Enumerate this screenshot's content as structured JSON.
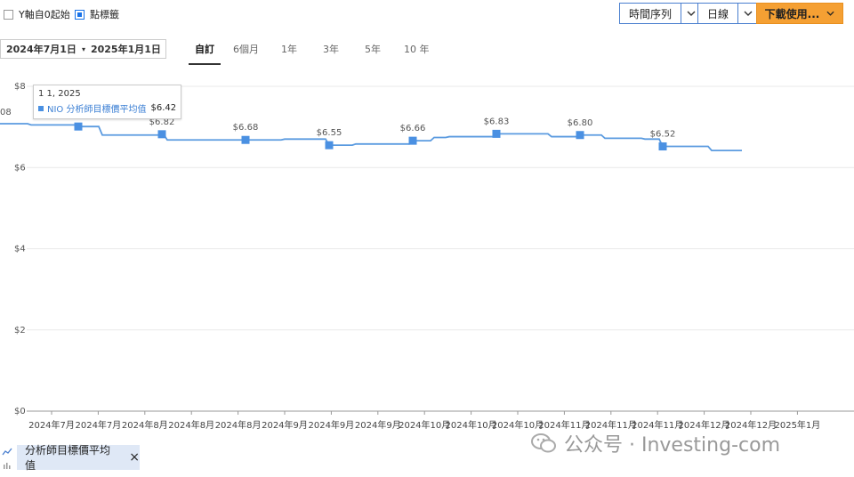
{
  "toolbar": {
    "y_from_zero_label": "Y軸自0起始",
    "y_from_zero_checked": false,
    "point_labels_label": "點標籤",
    "point_labels_checked": true,
    "series_type_label": "時間序列",
    "frequency_label": "日線",
    "download_label": "下載使用..."
  },
  "date_range": {
    "start": "2024年7月1日",
    "end": "2025年1月1日"
  },
  "periods": [
    {
      "label": "自訂",
      "active": true
    },
    {
      "label": "6個月",
      "active": false
    },
    {
      "label": "1年",
      "active": false
    },
    {
      "label": "3年",
      "active": false
    },
    {
      "label": "5年",
      "active": false
    },
    {
      "label": "10 年",
      "active": false
    }
  ],
  "tooltip": {
    "date": "1 1, 2025",
    "series": "NIO 分析師目標價平均值",
    "value": "$6.42"
  },
  "left_cut_label": "08",
  "legend": {
    "label": "分析師目標價平均值",
    "close": "×"
  },
  "watermark": "公众号 · Investing-com",
  "colors": {
    "line": "#5b9be0",
    "marker": "#4a90e2",
    "accent": "#f5a033",
    "button_border": "#4a7fcf",
    "legend_bg": "#dfe8f6"
  },
  "chart_data": {
    "type": "line",
    "series": [
      {
        "name": "分析師目標價平均值",
        "x": [
          "2024年7月",
          "2024年7月",
          "2024年7月",
          "2024年8月",
          "2024年8月",
          "2024年8月",
          "2024年8月",
          "2024年8月",
          "2024年9月",
          "2024年9月",
          "2024年9月",
          "2024年9月",
          "2024年10月",
          "2024年10月",
          "2024年10月",
          "2024年10月",
          "2024年10月",
          "2024年11月",
          "2024年11月",
          "2024年11月",
          "2024年11月",
          "2024年12月",
          "2024年12月",
          "2025年1月"
        ],
        "y": [
          7.08,
          7.05,
          7.01,
          6.8,
          6.8,
          6.82,
          6.68,
          6.68,
          6.7,
          6.7,
          6.55,
          6.58,
          6.66,
          6.74,
          6.76,
          6.83,
          6.83,
          6.76,
          6.8,
          6.72,
          6.7,
          6.52,
          6.42,
          6.42
        ]
      }
    ],
    "point_labels": [
      {
        "label": "$7.01",
        "y": 7.01
      },
      {
        "label": "$6.82",
        "y": 6.82
      },
      {
        "label": "$6.68",
        "y": 6.68
      },
      {
        "label": "$6.55",
        "y": 6.55
      },
      {
        "label": "$6.66",
        "y": 6.66
      },
      {
        "label": "$6.83",
        "y": 6.83
      },
      {
        "label": "$6.80",
        "y": 6.8
      },
      {
        "label": "$6.52",
        "y": 6.52
      }
    ],
    "y_ticks": [
      "$0",
      "$2",
      "$4",
      "$6",
      "$8"
    ],
    "y_tick_values": [
      0,
      2,
      4,
      6,
      8
    ],
    "ylim": [
      0,
      8
    ],
    "x_ticks": [
      "2024年7月",
      "2024年7月",
      "2024年8月",
      "2024年8月",
      "2024年8月",
      "2024年9月",
      "2024年9月",
      "2024年9月",
      "2024年10月",
      "2024年10月",
      "2024年10月",
      "2024年11月",
      "2024年11月",
      "2024年11月",
      "2024年12月",
      "2024年12月",
      "2025年1月"
    ],
    "grid": true,
    "legend": "bottom-left"
  }
}
